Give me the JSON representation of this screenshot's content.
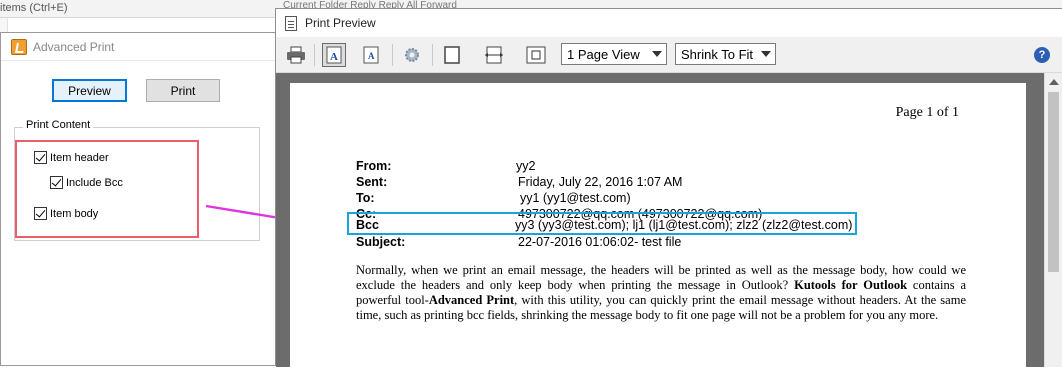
{
  "background": {
    "search_hint": "items (Ctrl+E)",
    "toolbar_fragment": "Current Folder     Reply     Reply All     Forward"
  },
  "advanced_print": {
    "title": "Advanced Print",
    "preview_label": "Preview",
    "print_label": "Print",
    "group_label": "Print Content",
    "checkboxes": [
      {
        "label": "Item header",
        "checked": true
      },
      {
        "label": "Include Bcc",
        "checked": true
      },
      {
        "label": "Item body",
        "checked": true
      }
    ],
    "highlight_color": "#ea5d6b"
  },
  "arrow_color": "#e033e0",
  "print_preview": {
    "title": "Print Preview",
    "page_view": "1 Page View",
    "fit_mode": "Shrink To Fit",
    "help_label": "?",
    "page": {
      "page_number": "Page 1 of 1",
      "headers": [
        {
          "label": "From:",
          "value": "yy2"
        },
        {
          "label": "Sent:",
          "value": "Friday, July 22, 2016 1:07 AM"
        },
        {
          "label": "To:",
          "value": "yy1 (yy1@test.com)"
        },
        {
          "label": "Cc:",
          "value": "497300722@qq.com (497300722@qq.com)"
        },
        {
          "label": "Bcc",
          "value": "yy3 (yy3@test.com); lj1 (lj1@test.com); zlz2 (zlz2@test.com)"
        },
        {
          "label": "Subject:",
          "value": "22-07-2016 01:06:02- test file"
        }
      ],
      "body_part1": "Normally, when we print an email message, the headers will be printed as well as the message body, how could we exclude the headers and only keep body when printing the message in Outlook? ",
      "body_bold1": "Kutools for Outlook",
      "body_part2": " contains a powerful tool-",
      "body_bold2": "Advanced Print",
      "body_part3": ", with this utility, you can quickly print the email message without headers. At the same time, such as printing bcc fields, shrinking the message body to fit one page will not be a problem for you any more.",
      "bcc_highlight_color": "#18a4d8"
    }
  }
}
